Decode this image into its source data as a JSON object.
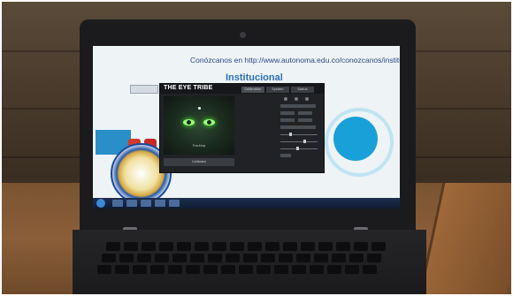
{
  "scene": "photo of a laptop on a wooden desk displaying a website and an eye-tracking calibration window",
  "browser": {
    "url_text": "Conózcanos en http://www.autonoma.edu.co/conozcanos/institucional",
    "headline": "Institucional"
  },
  "app": {
    "logo_text": "THE EYE TRIBE",
    "tabs": [
      "Calibration",
      "System",
      "Status"
    ],
    "active_tab": "Calibration",
    "calibrate_button": "Calibrate",
    "status_text": "Tracking"
  },
  "colors": {
    "eye_glow": "#9bff7a",
    "brand_blue": "#2e6fb8",
    "desk_wood": "#8a5e38"
  }
}
